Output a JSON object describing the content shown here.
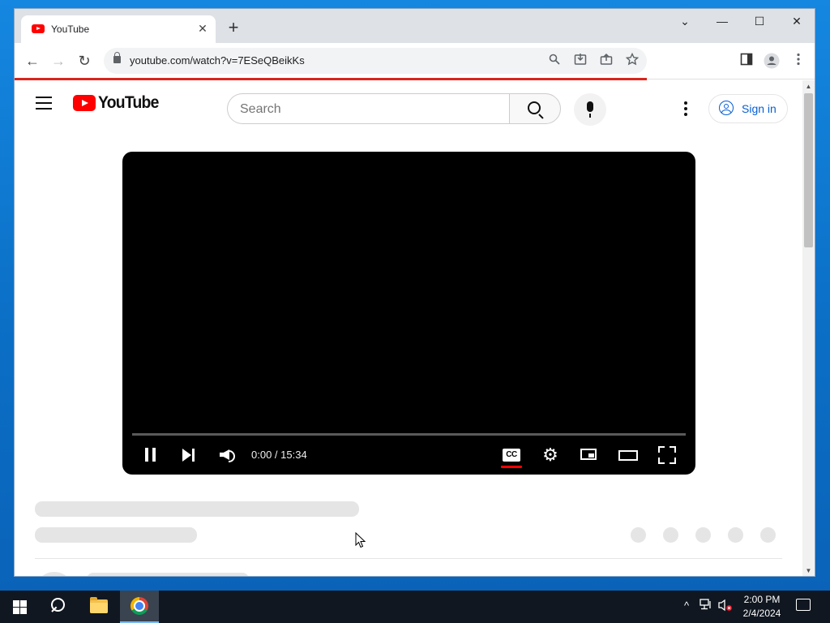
{
  "browser": {
    "tab_title": "YouTube",
    "tab_close": "✕",
    "new_tab": "+",
    "url": "youtube.com/watch?v=7ESeQBeikKs",
    "back": "←",
    "forward": "→",
    "reload": "↻",
    "minimize": "—",
    "maximize": "☐",
    "close": "✕",
    "tab_search": "⌄",
    "page_progress": 0.79
  },
  "youtube": {
    "logo_text": "YouTube",
    "search_placeholder": "Search",
    "sign_in_label": "Sign in"
  },
  "player": {
    "time_display": "0:00 / 15:34",
    "cc_label": "CC",
    "state": "playing"
  },
  "taskbar": {
    "clock_time": "2:00 PM",
    "clock_date": "2/4/2024",
    "tray_chevron": "^"
  },
  "colors": {
    "youtube_red": "#ff0000",
    "link_blue": "#065fd4",
    "taskbar": "#101720",
    "desktop": "#0b6fc6"
  }
}
